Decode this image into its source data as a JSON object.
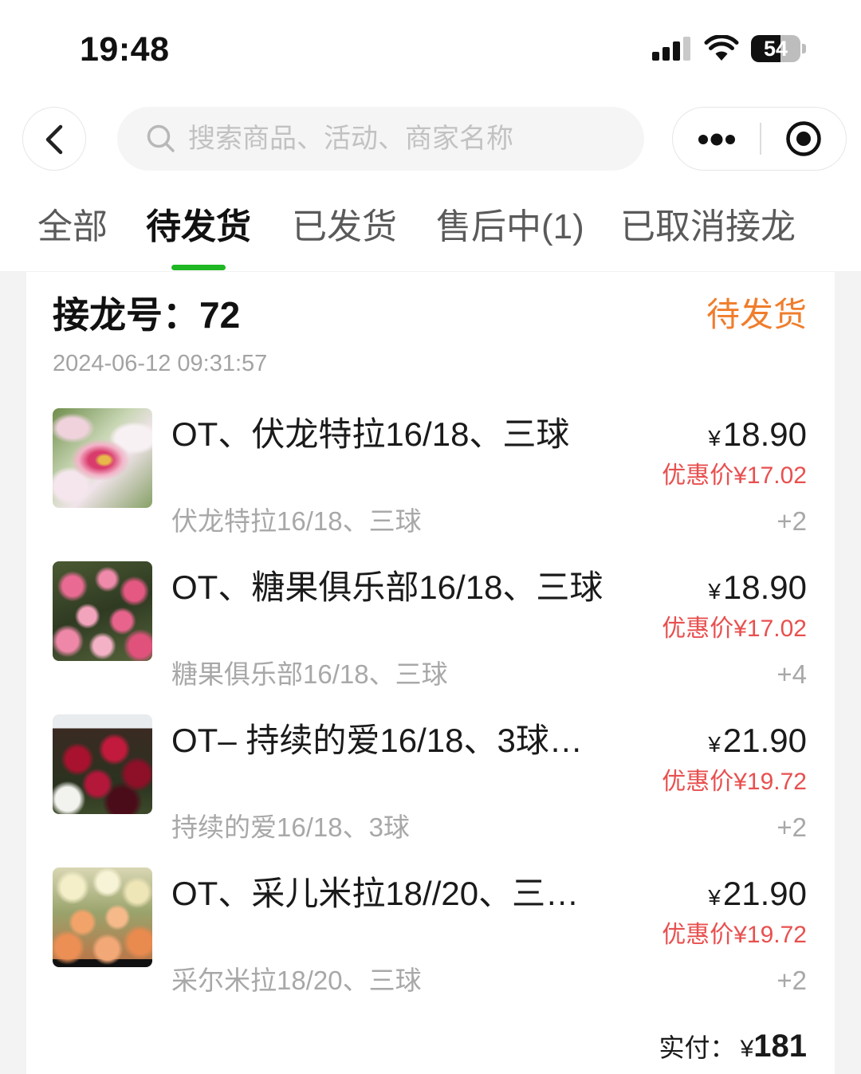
{
  "status_bar": {
    "time": "19:48",
    "battery": "54",
    "icons": [
      "cellular-signal-icon",
      "wifi-icon",
      "battery-icon"
    ]
  },
  "nav": {
    "back_icon": "chevron-left-icon",
    "search_icon": "search-icon",
    "search_placeholder": "搜索商品、活动、商家名称",
    "more_icon": "more-dots-icon",
    "close_icon": "target-icon"
  },
  "tabs": [
    {
      "label": "全部",
      "active": false
    },
    {
      "label": "待发货",
      "active": true
    },
    {
      "label": "已发货",
      "active": false
    },
    {
      "label": "售后中(1)",
      "active": false
    },
    {
      "label": "已取消接龙",
      "active": false
    }
  ],
  "order": {
    "id_label": "接龙号：",
    "id": "72",
    "status": "待发货",
    "datetime": "2024-06-12 09:31:57",
    "items": [
      {
        "title": "OT、伏龙特拉16/18、三球",
        "currency": "¥",
        "price": "18.90",
        "discount_label": "优惠价",
        "discount_price": "¥17.02",
        "spec": "伏龙特拉16/18、三球",
        "qty": "+2"
      },
      {
        "title": "OT、糖果俱乐部16/18、三球",
        "currency": "¥",
        "price": "18.90",
        "discount_label": "优惠价",
        "discount_price": "¥17.02",
        "spec": "糖果俱乐部16/18、三球",
        "qty": "+4"
      },
      {
        "title": "OT– 持续的爱16/18、3球…",
        "currency": "¥",
        "price": "21.90",
        "discount_label": "优惠价",
        "discount_price": "¥19.72",
        "spec": "持续的爱16/18、3球",
        "qty": "+2"
      },
      {
        "title": "OT、采儿米拉18//20、三…",
        "currency": "¥",
        "price": "21.90",
        "discount_label": "优惠价",
        "discount_price": "¥19.72",
        "spec": "采尔米拉18/20、三球",
        "qty": "+2"
      }
    ],
    "total_label": "实付：",
    "total_currency": "¥",
    "total_amount": "181"
  },
  "colors": {
    "accent_green": "#1fb723",
    "status_orange": "#f07d2c",
    "discount_red": "#e8504f"
  }
}
